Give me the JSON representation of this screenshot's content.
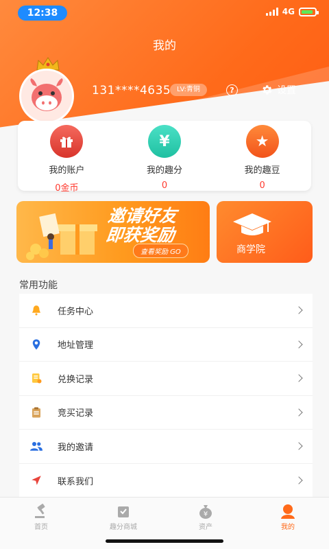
{
  "status_bar": {
    "time": "12:38",
    "network": "4G"
  },
  "header": {
    "title": "我的"
  },
  "profile": {
    "phone": "131****4635",
    "level": "LV:青铜",
    "help": "?",
    "settings_label": "设置"
  },
  "account": [
    {
      "label": "我的账户",
      "value": "0金币",
      "icon": "gift-icon",
      "color": "#e8453c"
    },
    {
      "label": "我的趣分",
      "value": "0",
      "icon": "yen-icon",
      "color": "#2fd3b4"
    },
    {
      "label": "我的趣豆",
      "value": "0",
      "icon": "star-icon",
      "color": "#ff6a1a"
    }
  ],
  "banners": {
    "invite_title_1": "邀请好友",
    "invite_title_2": "即获奖励",
    "invite_sub": "查看奖励 GO",
    "college": "商学院"
  },
  "section_title": "常用功能",
  "menu": [
    {
      "label": "任务中心",
      "icon": "bell-icon"
    },
    {
      "label": "地址管理",
      "icon": "location-pin-icon"
    },
    {
      "label": "兑换记录",
      "icon": "exchange-record-icon"
    },
    {
      "label": "竞买记录",
      "icon": "clipboard-icon"
    },
    {
      "label": "我的邀请",
      "icon": "users-icon"
    },
    {
      "label": "联系我们",
      "icon": "send-icon"
    }
  ],
  "tabs": [
    {
      "label": "首页",
      "icon": "gavel-icon",
      "active": false
    },
    {
      "label": "趣分商城",
      "icon": "shop-bag-icon",
      "active": false
    },
    {
      "label": "资产",
      "icon": "money-bag-icon",
      "active": false
    },
    {
      "label": "我的",
      "icon": "user-icon",
      "active": true
    }
  ],
  "colors": {
    "accent": "#ff6a1a",
    "red_value": "#ff3b30"
  }
}
